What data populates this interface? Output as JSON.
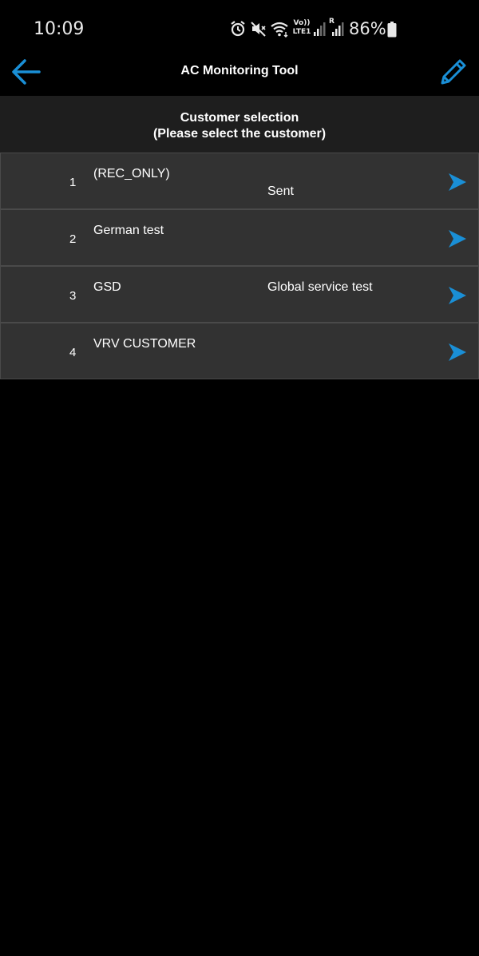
{
  "status_bar": {
    "time": "10:09",
    "battery": "86%",
    "icons": [
      "alarm-icon",
      "mute-icon",
      "wifi-icon",
      "volte-icon",
      "signal-icon",
      "roaming-signal-icon",
      "battery-icon"
    ],
    "volte_label": "Vo)) LTE1",
    "roaming_label": "R"
  },
  "app_bar": {
    "title": "AC Monitoring Tool",
    "back_icon": "arrow-left-icon",
    "edit_icon": "pencil-icon"
  },
  "header": {
    "title": "Customer selection",
    "subtitle": "(Please select the customer)"
  },
  "customers": [
    {
      "index": "1",
      "name": "(REC_ONLY)",
      "note": "",
      "status": "Sent"
    },
    {
      "index": "2",
      "name": "German test",
      "note": "",
      "status": ""
    },
    {
      "index": "3",
      "name": "GSD",
      "note": "Global service test",
      "status": ""
    },
    {
      "index": "4",
      "name": "VRV CUSTOMER",
      "note": "",
      "status": ""
    }
  ],
  "colors": {
    "accent": "#1a8fd6",
    "background": "#000000",
    "header_bg": "#1e1e1e",
    "row_bg": "#323232",
    "row_border": "#4a4a4a"
  }
}
